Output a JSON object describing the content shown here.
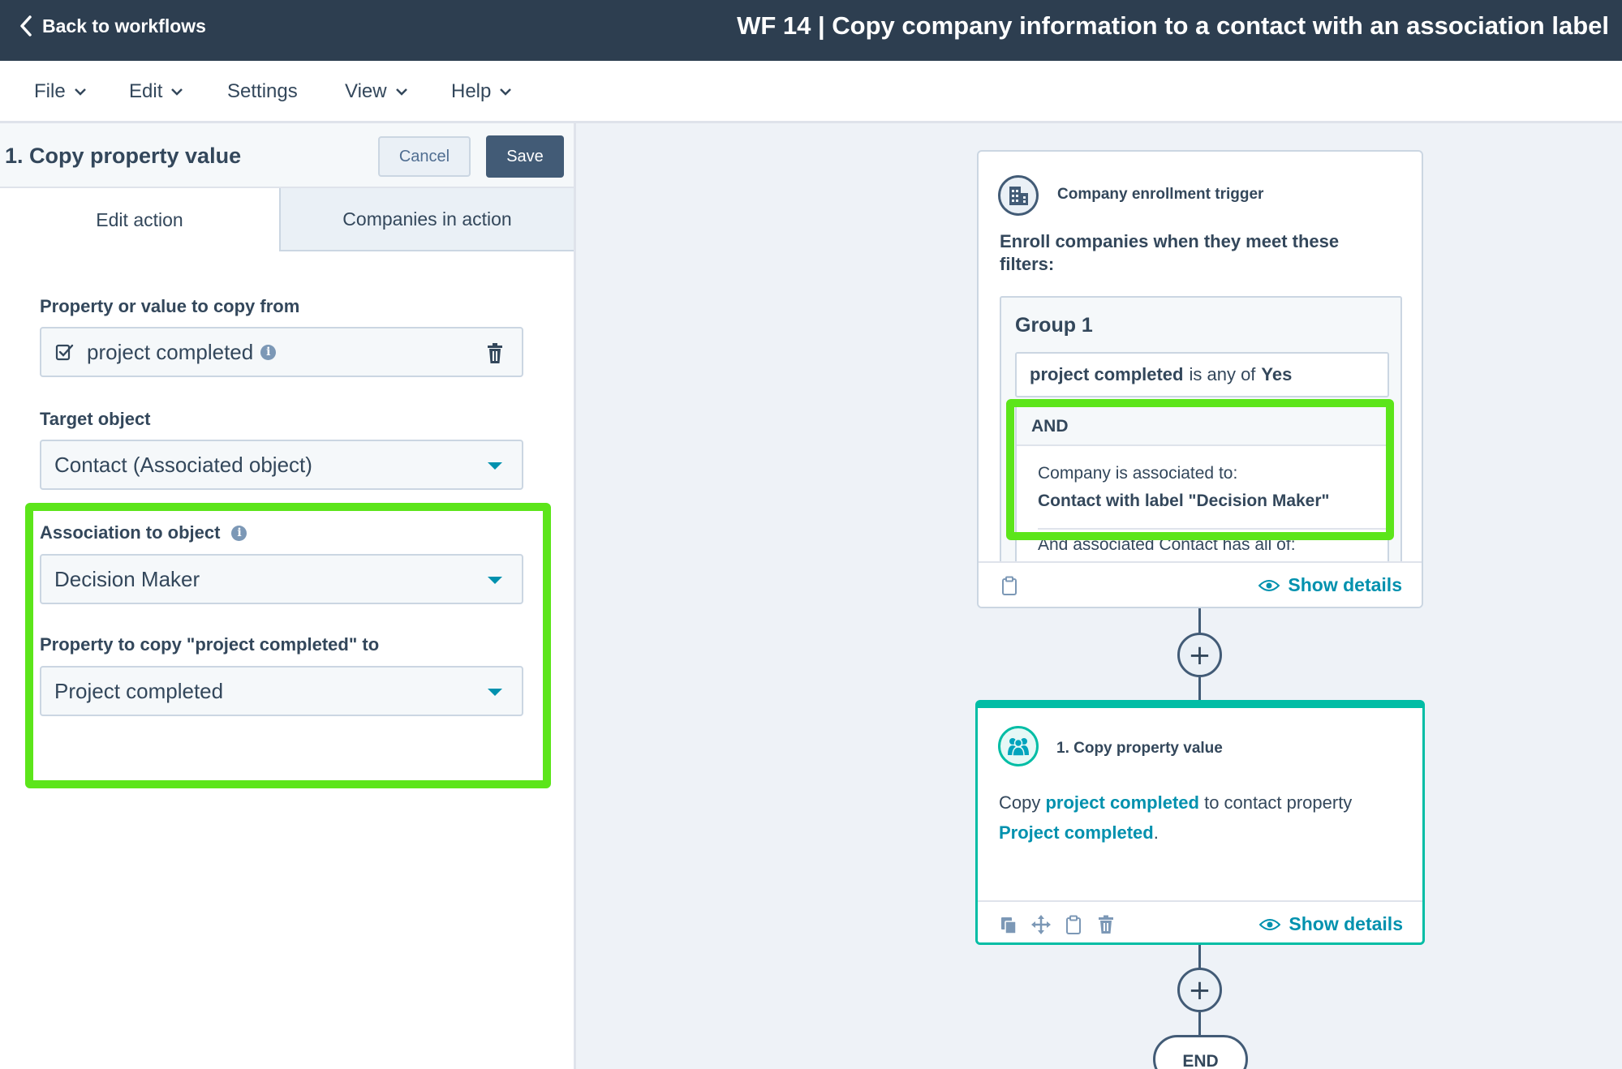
{
  "topbar": {
    "back_label": "Back to workflows",
    "workflow_title": "WF 14 | Copy company information to a contact with an association label"
  },
  "menu": [
    "File",
    "Edit",
    "Settings",
    "View",
    "Help"
  ],
  "panel": {
    "title": "1. Copy property value",
    "cancel_label": "Cancel",
    "save_label": "Save",
    "tabs": [
      "Edit action",
      "Companies in action"
    ],
    "fields": {
      "copy_from_label": "Property or value to copy from",
      "copy_from_value": "project completed",
      "target_label": "Target object",
      "target_value": "Contact (Associated object)",
      "association_label": "Association to object",
      "association_value": "Decision Maker",
      "copy_to_label": "Property to copy \"project completed\" to",
      "copy_to_value": "Project completed"
    }
  },
  "trigger_card": {
    "heading": "Company enrollment trigger",
    "description": "Enroll companies when they meet these filters:",
    "group_title": "Group 1",
    "filter": {
      "property": "project completed",
      "operator": "is any of",
      "value": "Yes"
    },
    "and_label": "AND",
    "assoc_text": "Company is associated to:",
    "assoc_value": "Contact with label \"Decision Maker\"",
    "and_more": "And associated Contact has all of:",
    "show_details": "Show details"
  },
  "action_card": {
    "heading": "1. Copy property value",
    "text_before": "Copy",
    "source_property": "project completed",
    "text_middle": "to contact property",
    "target_property": "Project completed",
    "text_after": ".",
    "show_details": "Show details"
  },
  "end_label": "END",
  "colors": {
    "topbar": "#2d3e50",
    "accent": "#0091ae",
    "highlight": "#5ce51a",
    "action_border": "#00bda5"
  }
}
